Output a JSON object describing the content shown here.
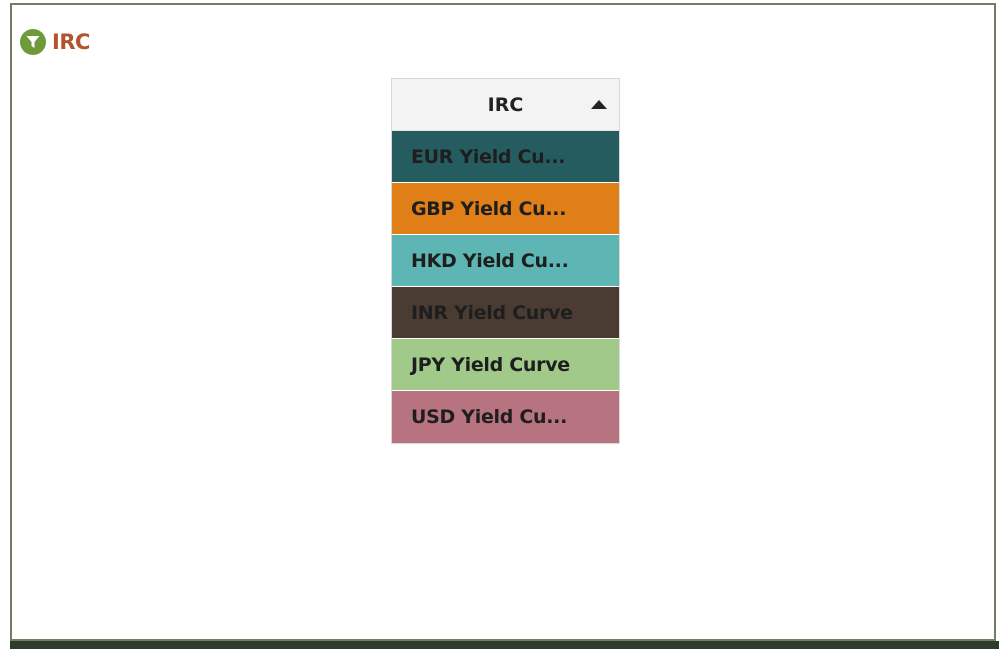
{
  "panel": {
    "title": "IRC",
    "icon": "filter-icon",
    "title_color": "#b2542e",
    "icon_color": "#6f9a3a",
    "border_color": "#707f62"
  },
  "filter_list": {
    "header": "IRC",
    "sort_icon": "sort-ascending-icon",
    "items": [
      {
        "label": "EUR Yield Cu...",
        "color": "#255c60"
      },
      {
        "label": "GBP Yield Cu...",
        "color": "#e07e18"
      },
      {
        "label": "HKD Yield Cu...",
        "color": "#5db6b3"
      },
      {
        "label": "INR Yield Curve",
        "color": "#4a3c33"
      },
      {
        "label": "JPY Yield Curve",
        "color": "#a0c98a"
      },
      {
        "label": "USD Yield Cu...",
        "color": "#b87380"
      }
    ]
  }
}
